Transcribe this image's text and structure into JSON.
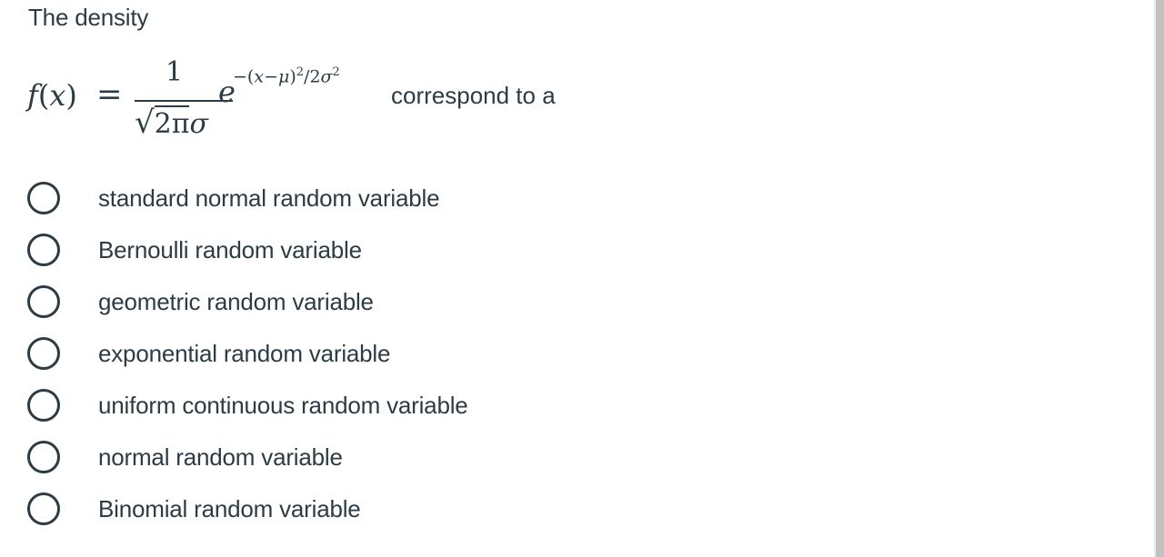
{
  "question": {
    "intro": "The density",
    "formula": {
      "lhs_f": "f",
      "lhs_open": "(",
      "lhs_x": "x",
      "lhs_close": ")",
      "equals": "=",
      "numerator": "1",
      "radical": "√",
      "radicand": "2π",
      "denominator_sigma": "σ",
      "base": "e",
      "exponent_prefix": "−(",
      "exponent_x": "x",
      "exponent_minus": "−",
      "exponent_mu": "μ",
      "exponent_close": ")",
      "exponent_sq": "2",
      "exponent_div": "/2",
      "exponent_sigma": "σ",
      "exponent_sigma_sq": "2",
      "latex": "f(x) = \\frac{1}{\\sqrt{2\\pi}\\sigma} e^{-(x-\\mu)^2/2\\sigma^2}"
    },
    "tail": "correspond to a"
  },
  "options": [
    {
      "label": "standard normal random variable",
      "selected": false
    },
    {
      "label": "Bernoulli random variable",
      "selected": false
    },
    {
      "label": "geometric random variable",
      "selected": false
    },
    {
      "label": "exponential random variable",
      "selected": false
    },
    {
      "label": "uniform continuous random variable",
      "selected": false
    },
    {
      "label": "normal random variable",
      "selected": false
    },
    {
      "label": "Binomial random variable",
      "selected": false
    }
  ],
  "colors": {
    "text": "#2d3b45",
    "radio_border": "#2d3b45",
    "background": "#ffffff",
    "scrollbar": "#c2c2c2"
  }
}
